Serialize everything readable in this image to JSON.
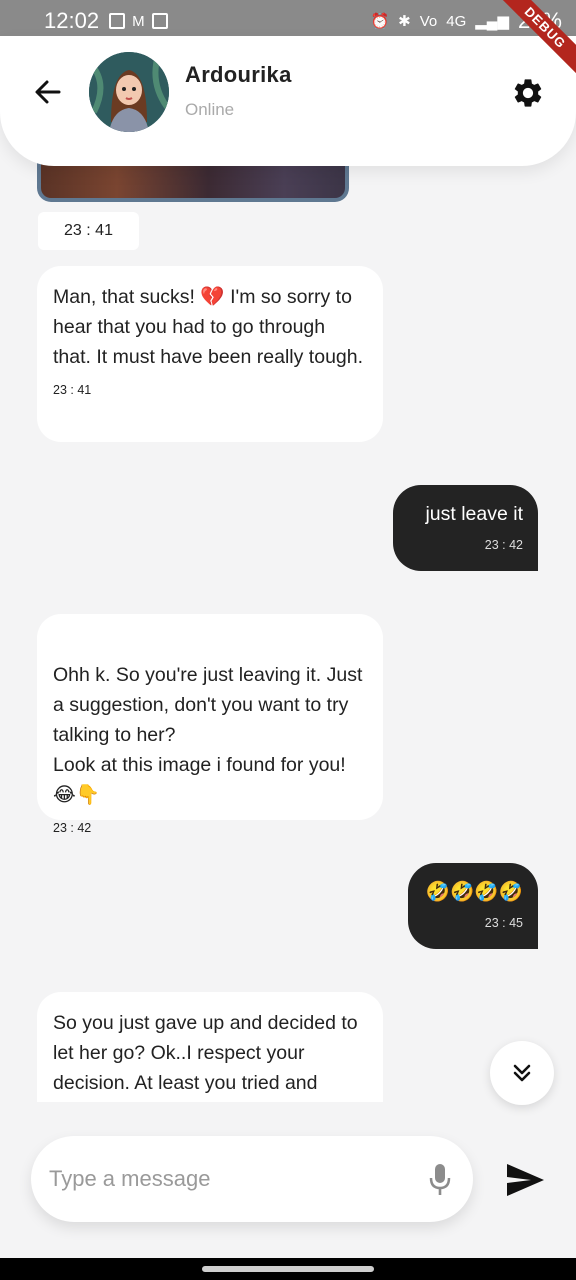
{
  "status_bar": {
    "time": "12:02",
    "network": "4G",
    "battery": "29%",
    "debug_label": "DEBUG"
  },
  "header": {
    "contact_name": "Ardourika",
    "contact_status": "Online"
  },
  "messages": [
    {
      "direction": "incoming",
      "type": "image",
      "time": "23 : 41"
    },
    {
      "direction": "incoming",
      "text": "Man, that sucks! 💔 I'm so sorry to hear that you had to go through that. It must have been really tough.",
      "time": "23 : 41"
    },
    {
      "direction": "outgoing",
      "text": "just leave it",
      "time": "23 : 42"
    },
    {
      "direction": "incoming",
      "text": "Ohh k. So you're just leaving it. Just a suggestion, don't you want to try talking to her?\n Look at this image i found for you!😂👇",
      "time": "23 : 42"
    },
    {
      "direction": "outgoing",
      "text": "🤣🤣🤣🤣",
      "time": "23 : 45"
    },
    {
      "direction": "incoming",
      "text": "So you just gave up and decided to let her go? Ok..I respect your decision. At least you tried and"
    }
  ],
  "composer": {
    "placeholder": "Type a message",
    "value": ""
  },
  "icons": {
    "back": "arrow-left-icon",
    "settings": "gear-icon",
    "scroll_down": "double-chevron-down-icon",
    "mic": "microphone-icon",
    "send": "send-icon"
  },
  "colors": {
    "outgoing_bubble": "#232323",
    "incoming_bubble": "#ffffff",
    "background": "#f4f4f5",
    "debug_ribbon": "#b3261e"
  }
}
